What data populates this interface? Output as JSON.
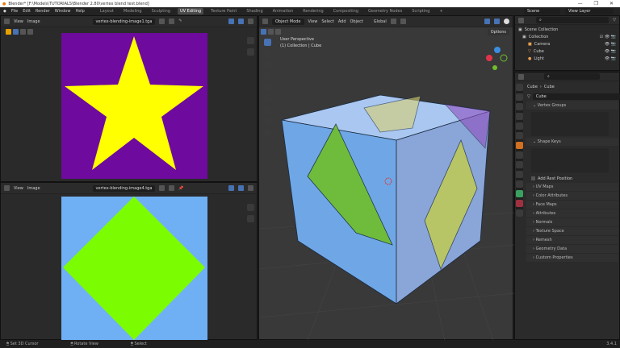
{
  "window": {
    "title": "Blender* [F:\\Models\\TUTORIALS\\Blender 2.80\\vertex blend test.blend]",
    "minimize": "—",
    "maximize": "❐",
    "close": "✕"
  },
  "menu": [
    "File",
    "Edit",
    "Render",
    "Window",
    "Help"
  ],
  "workspaces": [
    "Layout",
    "Modeling",
    "Sculpting",
    "UV Editing",
    "Texture Paint",
    "Shading",
    "Animation",
    "Rendering",
    "Compositing",
    "Geometry Nodes",
    "Scripting",
    "+"
  ],
  "active_workspace": "UV Editing",
  "scene": "Scene",
  "view_layer": "View Layer",
  "image_editor_top": {
    "view": "View",
    "image": "Image",
    "image_name": "vertex-blending-image1.tga",
    "colors": {
      "background": "#6e0a9e",
      "star": "#ffff00"
    }
  },
  "image_editor_bottom": {
    "view": "View",
    "image": "Image",
    "image_name": "vertex-blending-image4.tga",
    "colors": {
      "background": "#6fb0f5",
      "diamond": "#7cfc00"
    }
  },
  "viewport": {
    "mode": "Object Mode",
    "menus": [
      "View",
      "Select",
      "Add",
      "Object"
    ],
    "orientation": "Global",
    "options": "Options",
    "perspective": "User Perspective",
    "collection_info": "(1) Collection | Cube"
  },
  "outliner": {
    "root": "Scene Collection",
    "items": [
      {
        "label": "Collection",
        "indent": 1
      },
      {
        "label": "Camera",
        "indent": 2
      },
      {
        "label": "Cube",
        "indent": 2
      },
      {
        "label": "Light",
        "indent": 2
      }
    ]
  },
  "properties": {
    "breadcrumb_object": "Cube",
    "breadcrumb_mesh": "Cube",
    "mesh_name": "Cube",
    "vertex_groups": "Vertex Groups",
    "shape_keys": "Shape Keys",
    "add_rest_position": "Add Rest Position",
    "panels": [
      "UV Maps",
      "Color Attributes",
      "Face Maps",
      "Attributes",
      "Normals",
      "Texture Space",
      "Remesh",
      "Geometry Data",
      "Custom Properties"
    ]
  },
  "status": {
    "left": "Set 3D Cursor",
    "middle": "Rotate View",
    "right": "Select",
    "version": "3.4.1"
  }
}
